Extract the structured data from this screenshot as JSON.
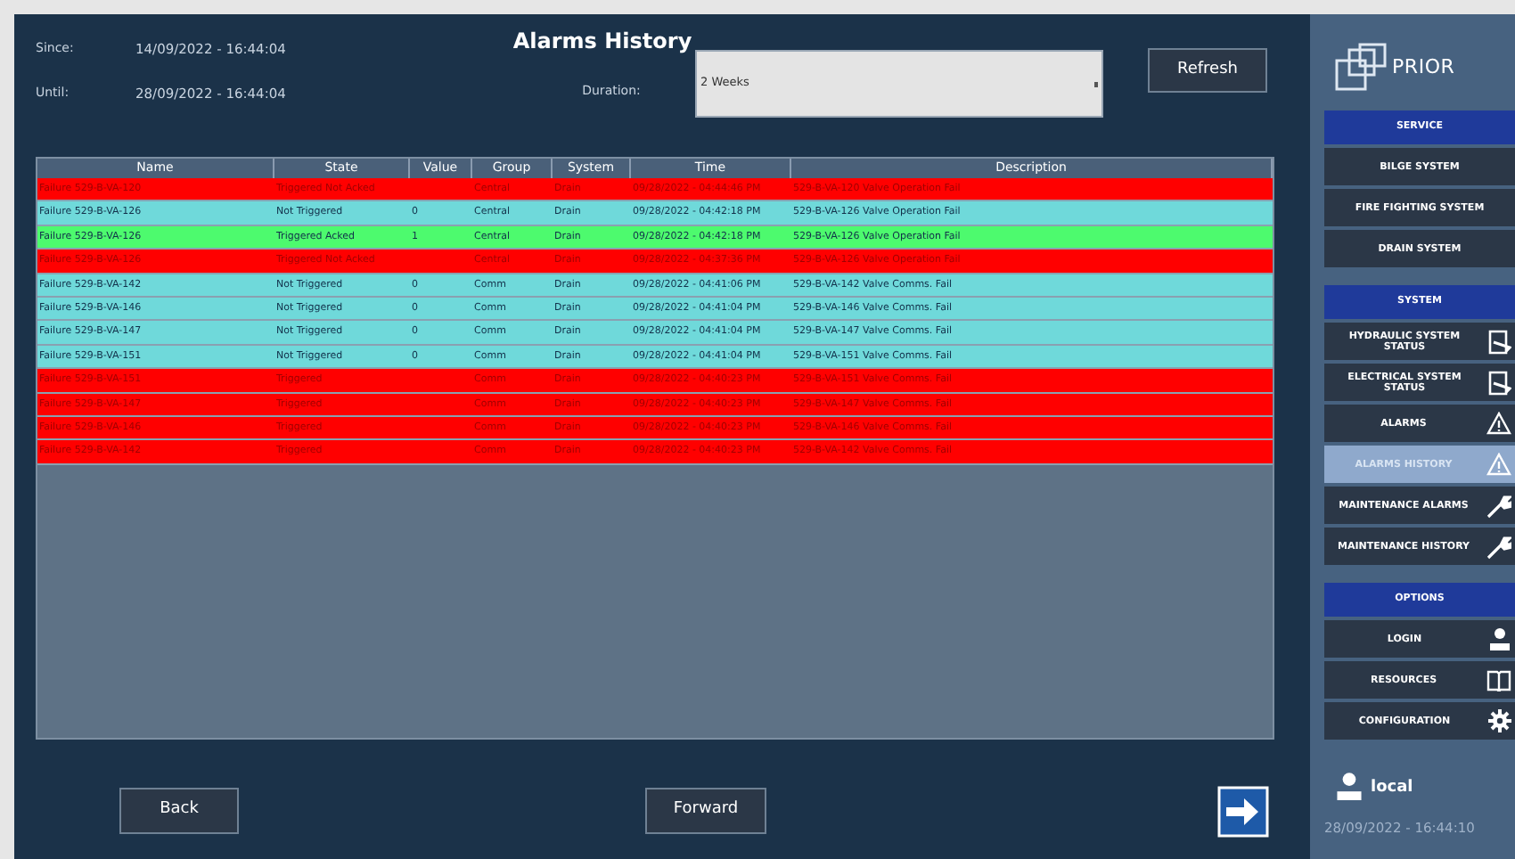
{
  "title": "Alarms History",
  "since": {
    "label": "Since:",
    "value": "14/09/2022 - 16:44:04"
  },
  "until": {
    "label": "Until:",
    "value": "28/09/2022 - 16:44:04"
  },
  "duration": {
    "label": "Duration:",
    "value": "2 Weeks"
  },
  "refresh": "Refresh",
  "table": {
    "columns": [
      "Name",
      "State",
      "Value",
      "Group",
      "System",
      "Time",
      "Description"
    ],
    "rows": [
      {
        "color": "#ff0000",
        "cells": [
          "Failure 529-B-VA-120",
          "Triggered Not Acked",
          "",
          "Central",
          "Drain",
          "09/28/2022 - 04:44:46 PM",
          "529-B-VA-120 Valve Operation Fail"
        ]
      },
      {
        "color": "#6fd9da",
        "cells": [
          "Failure 529-B-VA-126",
          "Not Triggered",
          "0",
          "Central",
          "Drain",
          "09/28/2022 - 04:42:18 PM",
          "529-B-VA-126 Valve Operation Fail"
        ]
      },
      {
        "color": "#4dfa6e",
        "cells": [
          "Failure 529-B-VA-126",
          "Triggered Acked",
          "1",
          "Central",
          "Drain",
          "09/28/2022 - 04:42:18 PM",
          "529-B-VA-126 Valve Operation Fail"
        ]
      },
      {
        "color": "#ff0000",
        "cells": [
          "Failure 529-B-VA-126",
          "Triggered Not Acked",
          "",
          "Central",
          "Drain",
          "09/28/2022 - 04:37:36 PM",
          "529-B-VA-126 Valve Operation Fail"
        ]
      },
      {
        "color": "#6fd9da",
        "cells": [
          "Failure 529-B-VA-142",
          "Not Triggered",
          "0",
          "Comm",
          "Drain",
          "09/28/2022 - 04:41:06 PM",
          "529-B-VA-142 Valve Comms. Fail"
        ]
      },
      {
        "color": "#6fd9da",
        "cells": [
          "Failure 529-B-VA-146",
          "Not Triggered",
          "0",
          "Comm",
          "Drain",
          "09/28/2022 - 04:41:04 PM",
          "529-B-VA-146 Valve Comms. Fail"
        ]
      },
      {
        "color": "#6fd9da",
        "cells": [
          "Failure 529-B-VA-147",
          "Not Triggered",
          "0",
          "Comm",
          "Drain",
          "09/28/2022 - 04:41:04 PM",
          "529-B-VA-147 Valve Comms. Fail"
        ]
      },
      {
        "color": "#6fd9da",
        "cells": [
          "Failure 529-B-VA-151",
          "Not Triggered",
          "0",
          "Comm",
          "Drain",
          "09/28/2022 - 04:41:04 PM",
          "529-B-VA-151 Valve Comms. Fail"
        ]
      },
      {
        "color": "#ff0000",
        "cells": [
          "Failure 529-B-VA-151",
          "Triggered",
          "",
          "Comm",
          "Drain",
          "09/28/2022 - 04:40:23 PM",
          "529-B-VA-151 Valve Comms. Fail"
        ]
      },
      {
        "color": "#ff0000",
        "cells": [
          "Failure 529-B-VA-147",
          "Triggered",
          "",
          "Comm",
          "Drain",
          "09/28/2022 - 04:40:23 PM",
          "529-B-VA-147 Valve Comms. Fail"
        ]
      },
      {
        "color": "#ff0000",
        "cells": [
          "Failure 529-B-VA-146",
          "Triggered",
          "",
          "Comm",
          "Drain",
          "09/28/2022 - 04:40:23 PM",
          "529-B-VA-146 Valve Comms. Fail"
        ]
      },
      {
        "color": "#ff0000",
        "cells": [
          "Failure 529-B-VA-142",
          "Triggered",
          "",
          "Comm",
          "Drain",
          "09/28/2022 - 04:40:23 PM",
          "529-B-VA-142 Valve Comms. Fail"
        ]
      }
    ]
  },
  "buttons": {
    "back": "Back",
    "forward": "Forward"
  },
  "logo": "PRIOR",
  "sidebar": [
    {
      "header": "SERVICE",
      "items": [
        {
          "label": "BILGE SYSTEM",
          "selected": false
        },
        {
          "label": "FIRE FIGHTING SYSTEM",
          "selected": false
        },
        {
          "label": "DRAIN SYSTEM",
          "selected": false
        }
      ]
    },
    {
      "header": "SYSTEM",
      "items": [
        {
          "label": "HYDRAULIC SYSTEM STATUS",
          "selected": false
        },
        {
          "label": "ELECTRICAL SYSTEM STATUS",
          "selected": false
        },
        {
          "label": "ALARMS",
          "selected": false
        },
        {
          "label": "ALARMS HISTORY",
          "selected": true
        },
        {
          "label": "MAINTENANCE ALARMS",
          "selected": false
        },
        {
          "label": "MAINTENANCE HISTORY",
          "selected": false
        }
      ]
    },
    {
      "header": "OPTIONS",
      "items": [
        {
          "label": "LOGIN",
          "selected": false
        },
        {
          "label": "RESOURCES",
          "selected": false
        },
        {
          "label": "CONFIGURATION",
          "selected": false
        }
      ]
    }
  ],
  "user": "local",
  "clock": "28/09/2022 - 16:44:10"
}
